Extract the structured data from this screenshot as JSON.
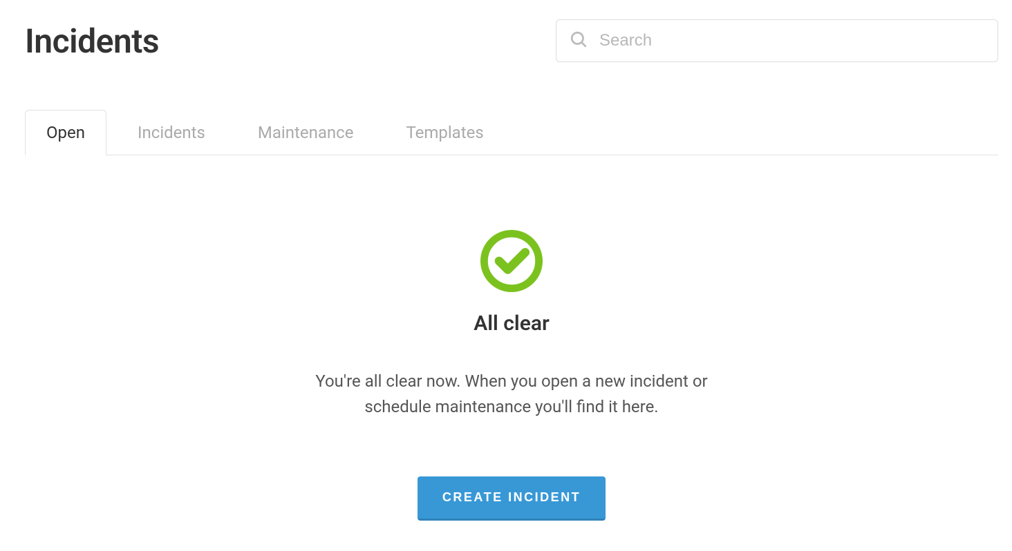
{
  "header": {
    "title": "Incidents",
    "search_placeholder": "Search"
  },
  "tabs": [
    {
      "label": "Open",
      "active": true
    },
    {
      "label": "Incidents",
      "active": false
    },
    {
      "label": "Maintenance",
      "active": false
    },
    {
      "label": "Templates",
      "active": false
    }
  ],
  "empty_state": {
    "title": "All clear",
    "message": "You're all clear now. When you open a new incident or schedule maintenance you'll find it here.",
    "button_label": "CREATE INCIDENT"
  },
  "colors": {
    "accent_green": "#7bc21f",
    "accent_blue": "#3898d6"
  }
}
